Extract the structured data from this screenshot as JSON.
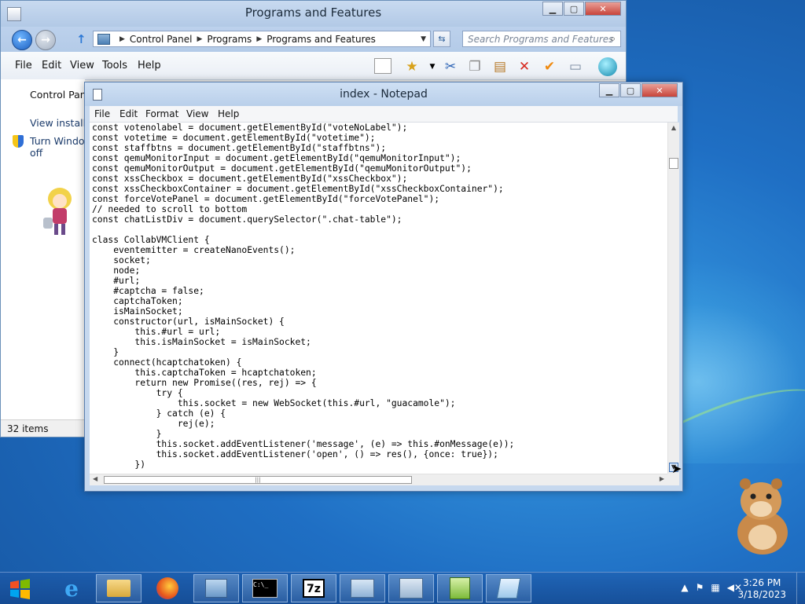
{
  "control_panel": {
    "title": "Programs and Features",
    "breadcrumbs": [
      "Control Panel",
      "Programs",
      "Programs and Features"
    ],
    "search_placeholder": "Search Programs and Features",
    "menu": [
      "File",
      "Edit",
      "View",
      "Tools",
      "Help"
    ],
    "left_links": [
      "Control Panel",
      "View installed",
      "Turn Window",
      "off"
    ],
    "status": "32 items"
  },
  "notepad": {
    "title": "index - Notepad",
    "menu": [
      "File",
      "Edit",
      "Format",
      "View",
      "Help"
    ],
    "lines": [
      "const votenolabel = document.getElementById(\"voteNoLabel\");",
      "const votetime = document.getElementById(\"votetime\");",
      "const staffbtns = document.getElementById(\"staffbtns\");",
      "const qemuMonitorInput = document.getElementById(\"qemuMonitorInput\");",
      "const qemuMonitorOutput = document.getElementById(\"qemuMonitorOutput\");",
      "const xssCheckbox = document.getElementById(\"xssCheckbox\");",
      "const xssCheckboxContainer = document.getElementById(\"xssCheckboxContainer\");",
      "const forceVotePanel = document.getElementById(\"forceVotePanel\");",
      "// needed to scroll to bottom",
      "const chatListDiv = document.querySelector(\".chat-table\");",
      "",
      "class CollabVMClient {",
      "    eventemitter = createNanoEvents();",
      "    socket;",
      "    node;",
      "    #url;",
      "    #captcha = false;",
      "    captchaToken;",
      "    isMainSocket;",
      "    constructor(url, isMainSocket) {",
      "        this.#url = url;",
      "        this.isMainSocket = isMainSocket;",
      "    }",
      "    connect(hcaptchatoken) {",
      "        this.captchaToken = hcaptchatoken;",
      "        return new Promise((res, rej) => {",
      "            try {",
      "                this.socket = new WebSocket(this.#url, \"guacamole\");",
      "            } catch (e) {",
      "                rej(e);",
      "            }",
      "            this.socket.addEventListener('message', (e) => this.#onMessage(e));",
      "            this.socket.addEventListener('open', () => res(), {once: true});",
      "        })"
    ]
  },
  "taskbar": {
    "time": "3:26 PM",
    "date": "3/18/2023",
    "apps": [
      "internet-explorer",
      "file-explorer",
      "firefox",
      "control-panel",
      "command-prompt",
      "7-zip",
      "task-manager",
      "network",
      "notepad-plus-plus",
      "notepad"
    ]
  }
}
